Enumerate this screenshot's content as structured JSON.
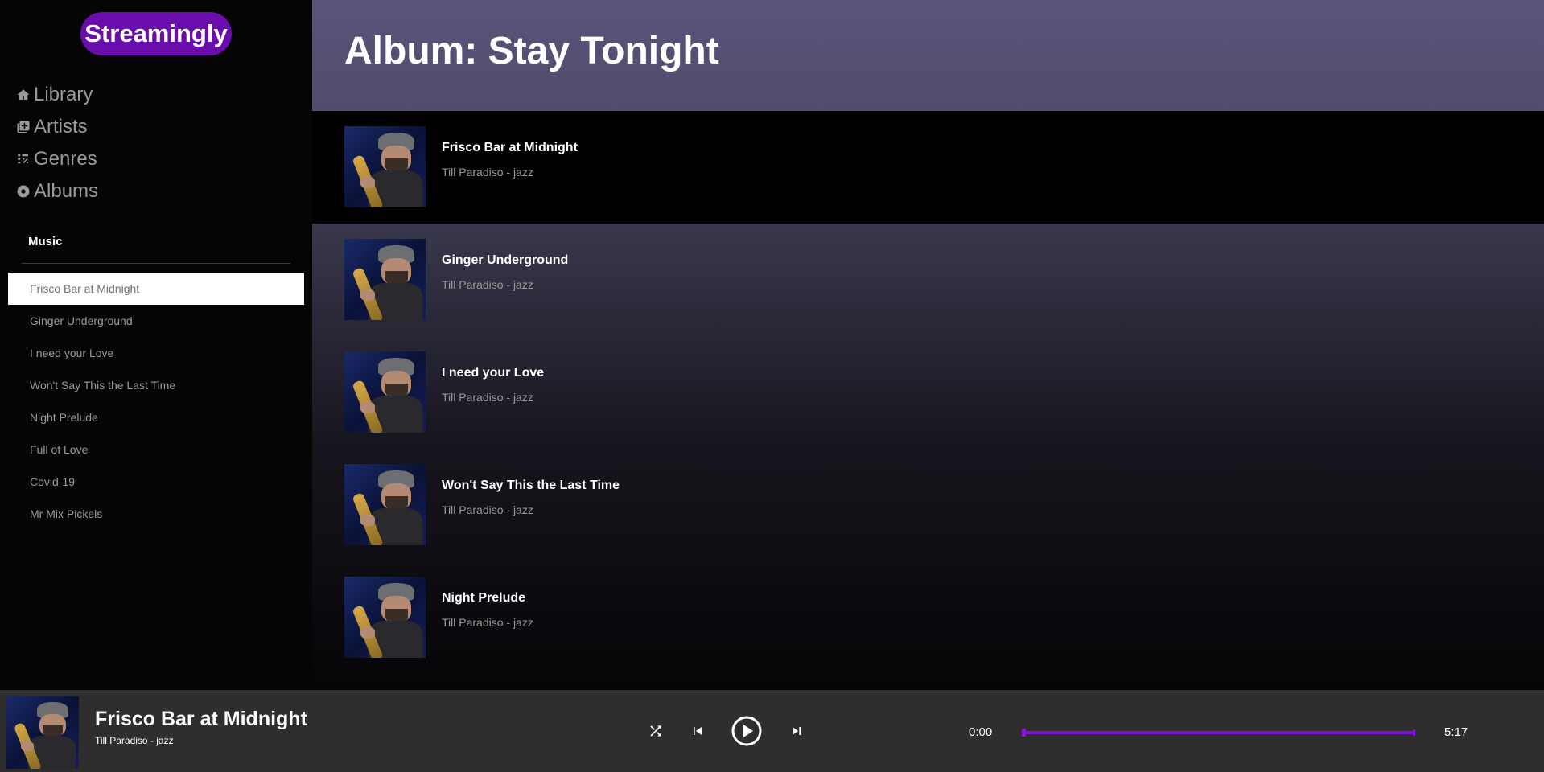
{
  "app": {
    "logo": "Streamingly",
    "accent": "#6a0dad"
  },
  "nav": [
    {
      "label": "Library",
      "icon": "home-icon"
    },
    {
      "label": "Artists",
      "icon": "library-icon"
    },
    {
      "label": "Genres",
      "icon": "genres-icon"
    },
    {
      "label": "Albums",
      "icon": "album-icon"
    }
  ],
  "sidebar": {
    "section_title": "Music",
    "tracks": [
      "Frisco Bar at Midnight",
      "Ginger Underground",
      "I need your Love",
      "Won't Say This the Last Time",
      "Night Prelude",
      "Full of Love",
      "Covid-19",
      "Mr Mix Pickels"
    ],
    "active_index": 0
  },
  "main": {
    "title": "Album: Stay Tonight",
    "songs": [
      {
        "title": "Frisco Bar at Midnight",
        "subtitle": "Till Paradiso - jazz"
      },
      {
        "title": "Ginger Underground",
        "subtitle": "Till Paradiso - jazz"
      },
      {
        "title": "I need your Love",
        "subtitle": "Till Paradiso - jazz"
      },
      {
        "title": "Won't Say This the Last Time",
        "subtitle": "Till Paradiso - jazz"
      },
      {
        "title": "Night Prelude",
        "subtitle": "Till Paradiso - jazz"
      }
    ]
  },
  "player": {
    "title": "Frisco Bar at Midnight",
    "subtitle": "Till Paradiso - jazz",
    "current_time": "0:00",
    "duration": "5:17",
    "progress_fraction": 0,
    "controls": [
      "shuffle-icon",
      "previous-icon",
      "play-icon",
      "next-icon"
    ]
  }
}
